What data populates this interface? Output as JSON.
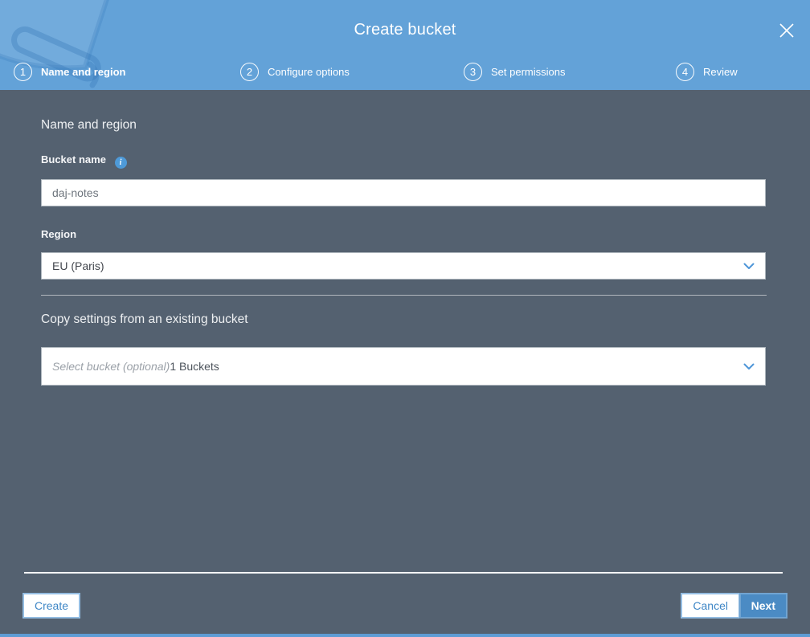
{
  "dialog": {
    "title": "Create bucket"
  },
  "steps": [
    {
      "number": "1",
      "label": "Name and region",
      "active": true
    },
    {
      "number": "2",
      "label": "Configure options",
      "active": false
    },
    {
      "number": "3",
      "label": "Set permissions",
      "active": false
    },
    {
      "number": "4",
      "label": "Review",
      "active": false
    }
  ],
  "form": {
    "section_title": "Name and region",
    "bucket_name": {
      "label": "Bucket name",
      "value": "daj-notes"
    },
    "region": {
      "label": "Region",
      "selected": "EU (Paris)"
    },
    "copy_settings": {
      "section_title": "Copy settings from an existing bucket",
      "placeholder": "Select bucket (optional)",
      "count_text": "1 Buckets"
    }
  },
  "footer": {
    "create_label": "Create",
    "cancel_label": "Cancel",
    "next_label": "Next"
  },
  "colors": {
    "header_blue": "#63a2d8",
    "body_background": "#546170",
    "accent_blue": "#4b8bc4",
    "link_blue": "#3e86c6",
    "white": "#ffffff"
  }
}
